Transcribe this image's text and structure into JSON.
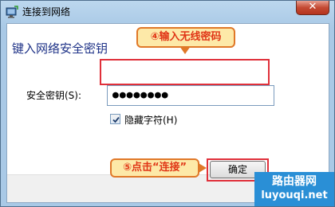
{
  "window": {
    "title": "连接到网络",
    "close_glyph": "✕"
  },
  "dialog": {
    "heading": "键入网络安全密钥",
    "key_label": "安全密钥(S):",
    "key_value": "●●●●●●●●",
    "hide_chars_label": "隐藏字符(H)",
    "hide_chars_checked": true,
    "ok_label": "确定"
  },
  "annotations": {
    "step4": "④输入无线密码",
    "step5": "⑤点击“连接”"
  },
  "watermark": {
    "name": "路由器网",
    "url": "luyouqi.net"
  },
  "colors": {
    "heading": "#1e3287",
    "highlight": "#e0303a",
    "callout_fill": "#fde9a8",
    "callout_text": "#e03516",
    "watermark_bg": "#2a8fd6"
  }
}
